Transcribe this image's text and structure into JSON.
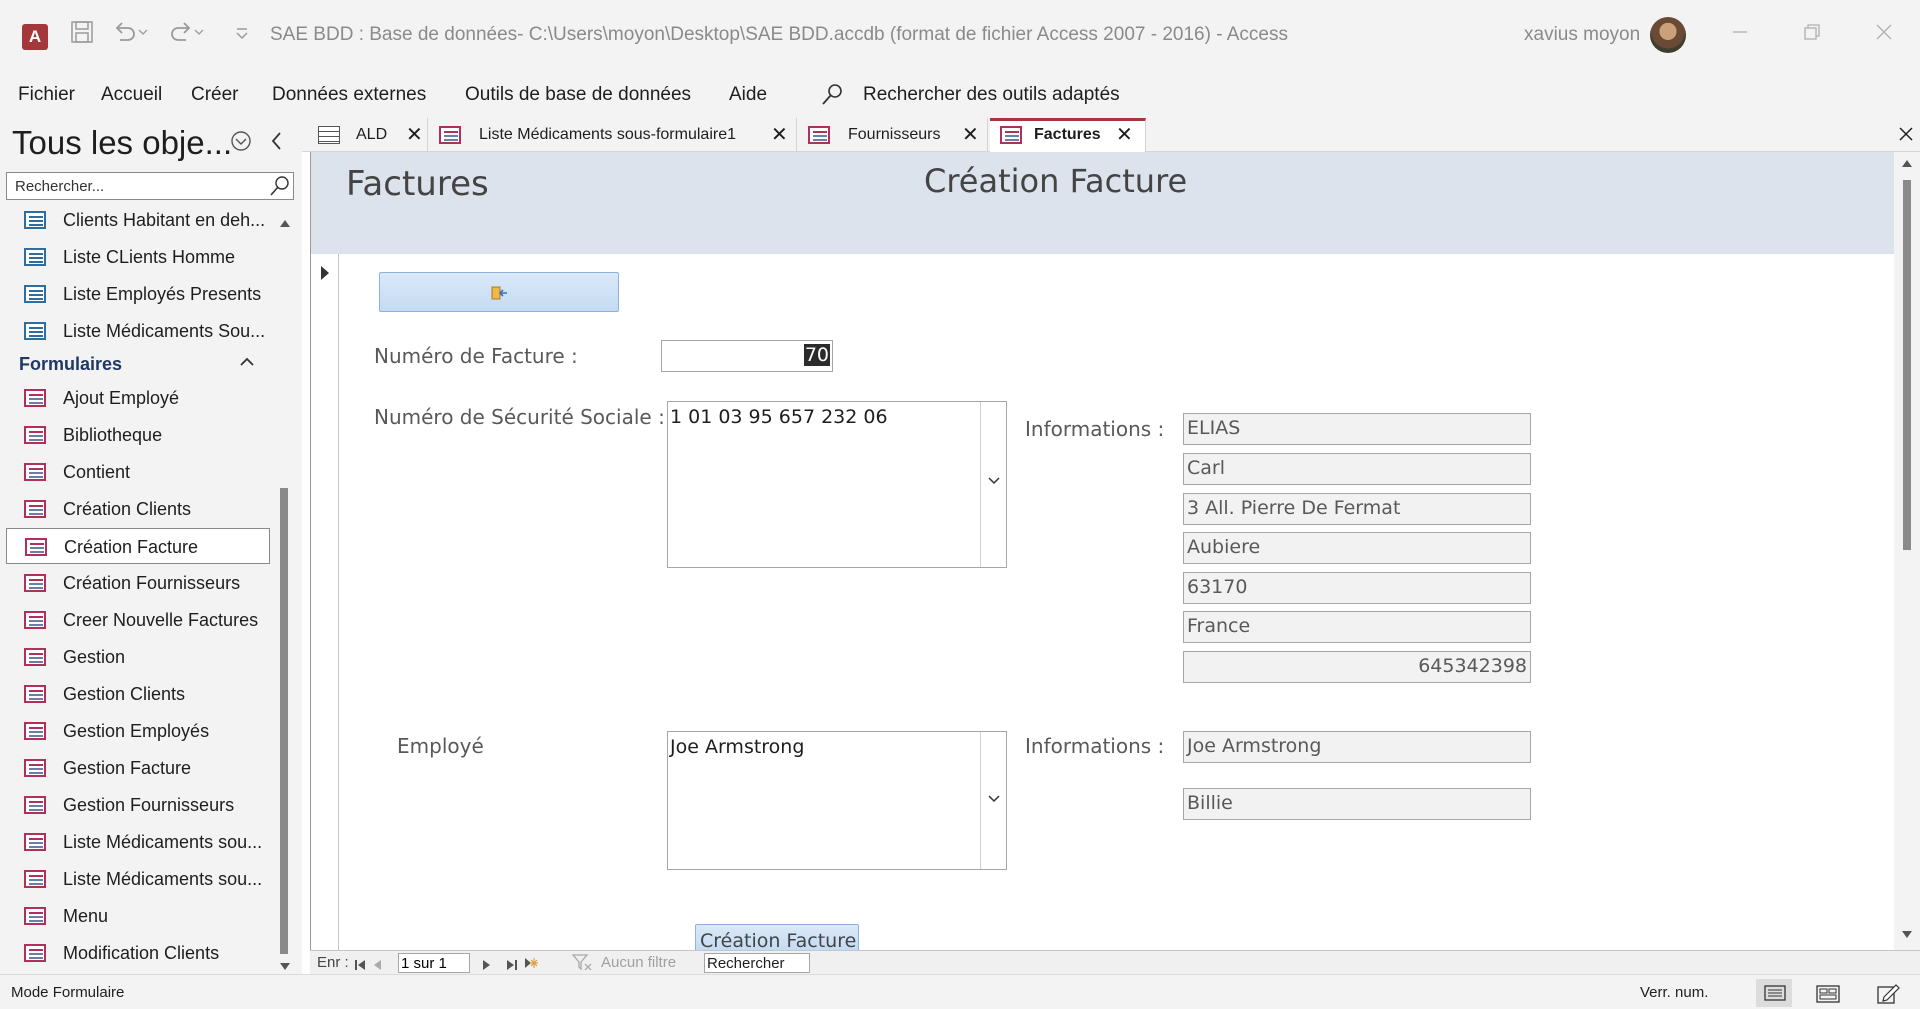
{
  "window": {
    "title": "SAE BDD : Base de données- C:\\Users\\moyon\\Desktop\\SAE BDD.accdb (format de fichier Access 2007 - 2016)  -  Access",
    "user": "xavius moyon",
    "app_icon_letter": "A"
  },
  "menu": {
    "items": [
      "Fichier",
      "Accueil",
      "Créer",
      "Données externes",
      "Outils de base de données",
      "Aide"
    ],
    "search": "Rechercher des outils adaptés"
  },
  "nav": {
    "title": "Tous les obje...",
    "search_placeholder": "Rechercher...",
    "queries": [
      "Clients Habitant en deh...",
      "Liste CLients Homme",
      "Liste Employés Presents",
      "Liste Médicaments Sou..."
    ],
    "section_forms": "Formulaires",
    "forms": [
      "Ajout Employé",
      "Bibliotheque",
      "Contient",
      "Création Clients",
      "Création Facture",
      "Création Fournisseurs",
      "Creer Nouvelle Factures",
      "Gestion",
      "Gestion Clients",
      "Gestion Employés",
      "Gestion Facture",
      "Gestion Fournisseurs",
      "Liste Médicaments sou...",
      "Liste Médicaments sou...",
      "Menu",
      "Modification Clients"
    ],
    "selected": "Création Facture"
  },
  "tabs": [
    {
      "label": "ALD",
      "icon": "table-icon"
    },
    {
      "label": "Liste Médicaments sous-formulaire1",
      "icon": "form-icon"
    },
    {
      "label": "Fournisseurs",
      "icon": "form-icon"
    },
    {
      "label": "Factures",
      "icon": "form-icon",
      "active": true
    }
  ],
  "form": {
    "header_title": "Factures",
    "header_subtitle": "Création Facture",
    "invoice_label": "Numéro de Facture :",
    "invoice_value": "70",
    "ssn_label": "Numéro de Sécurité Sociale :",
    "ssn_value": "1 01 03 95 657 232 06",
    "info_label": "Informations :",
    "client_info": [
      "ELIAS",
      "Carl",
      "3 All. Pierre De Fermat",
      "Aubiere",
      "63170",
      "France",
      "645342398"
    ],
    "employee_label": "Employé",
    "employee_value": "Joe Armstrong",
    "employee_info": [
      "Joe Armstrong",
      "Billie"
    ],
    "create_button": "Création Facture"
  },
  "recnav": {
    "label": "Enr :",
    "position": "1 sur 1",
    "filter": "Aucun filtre",
    "search": "Rechercher"
  },
  "status": {
    "mode": "Mode Formulaire",
    "numlock": "Verr. num."
  },
  "colors": {
    "accent": "#a4373a",
    "header_band": "#dce3ec",
    "section_head": "#1f3864"
  }
}
